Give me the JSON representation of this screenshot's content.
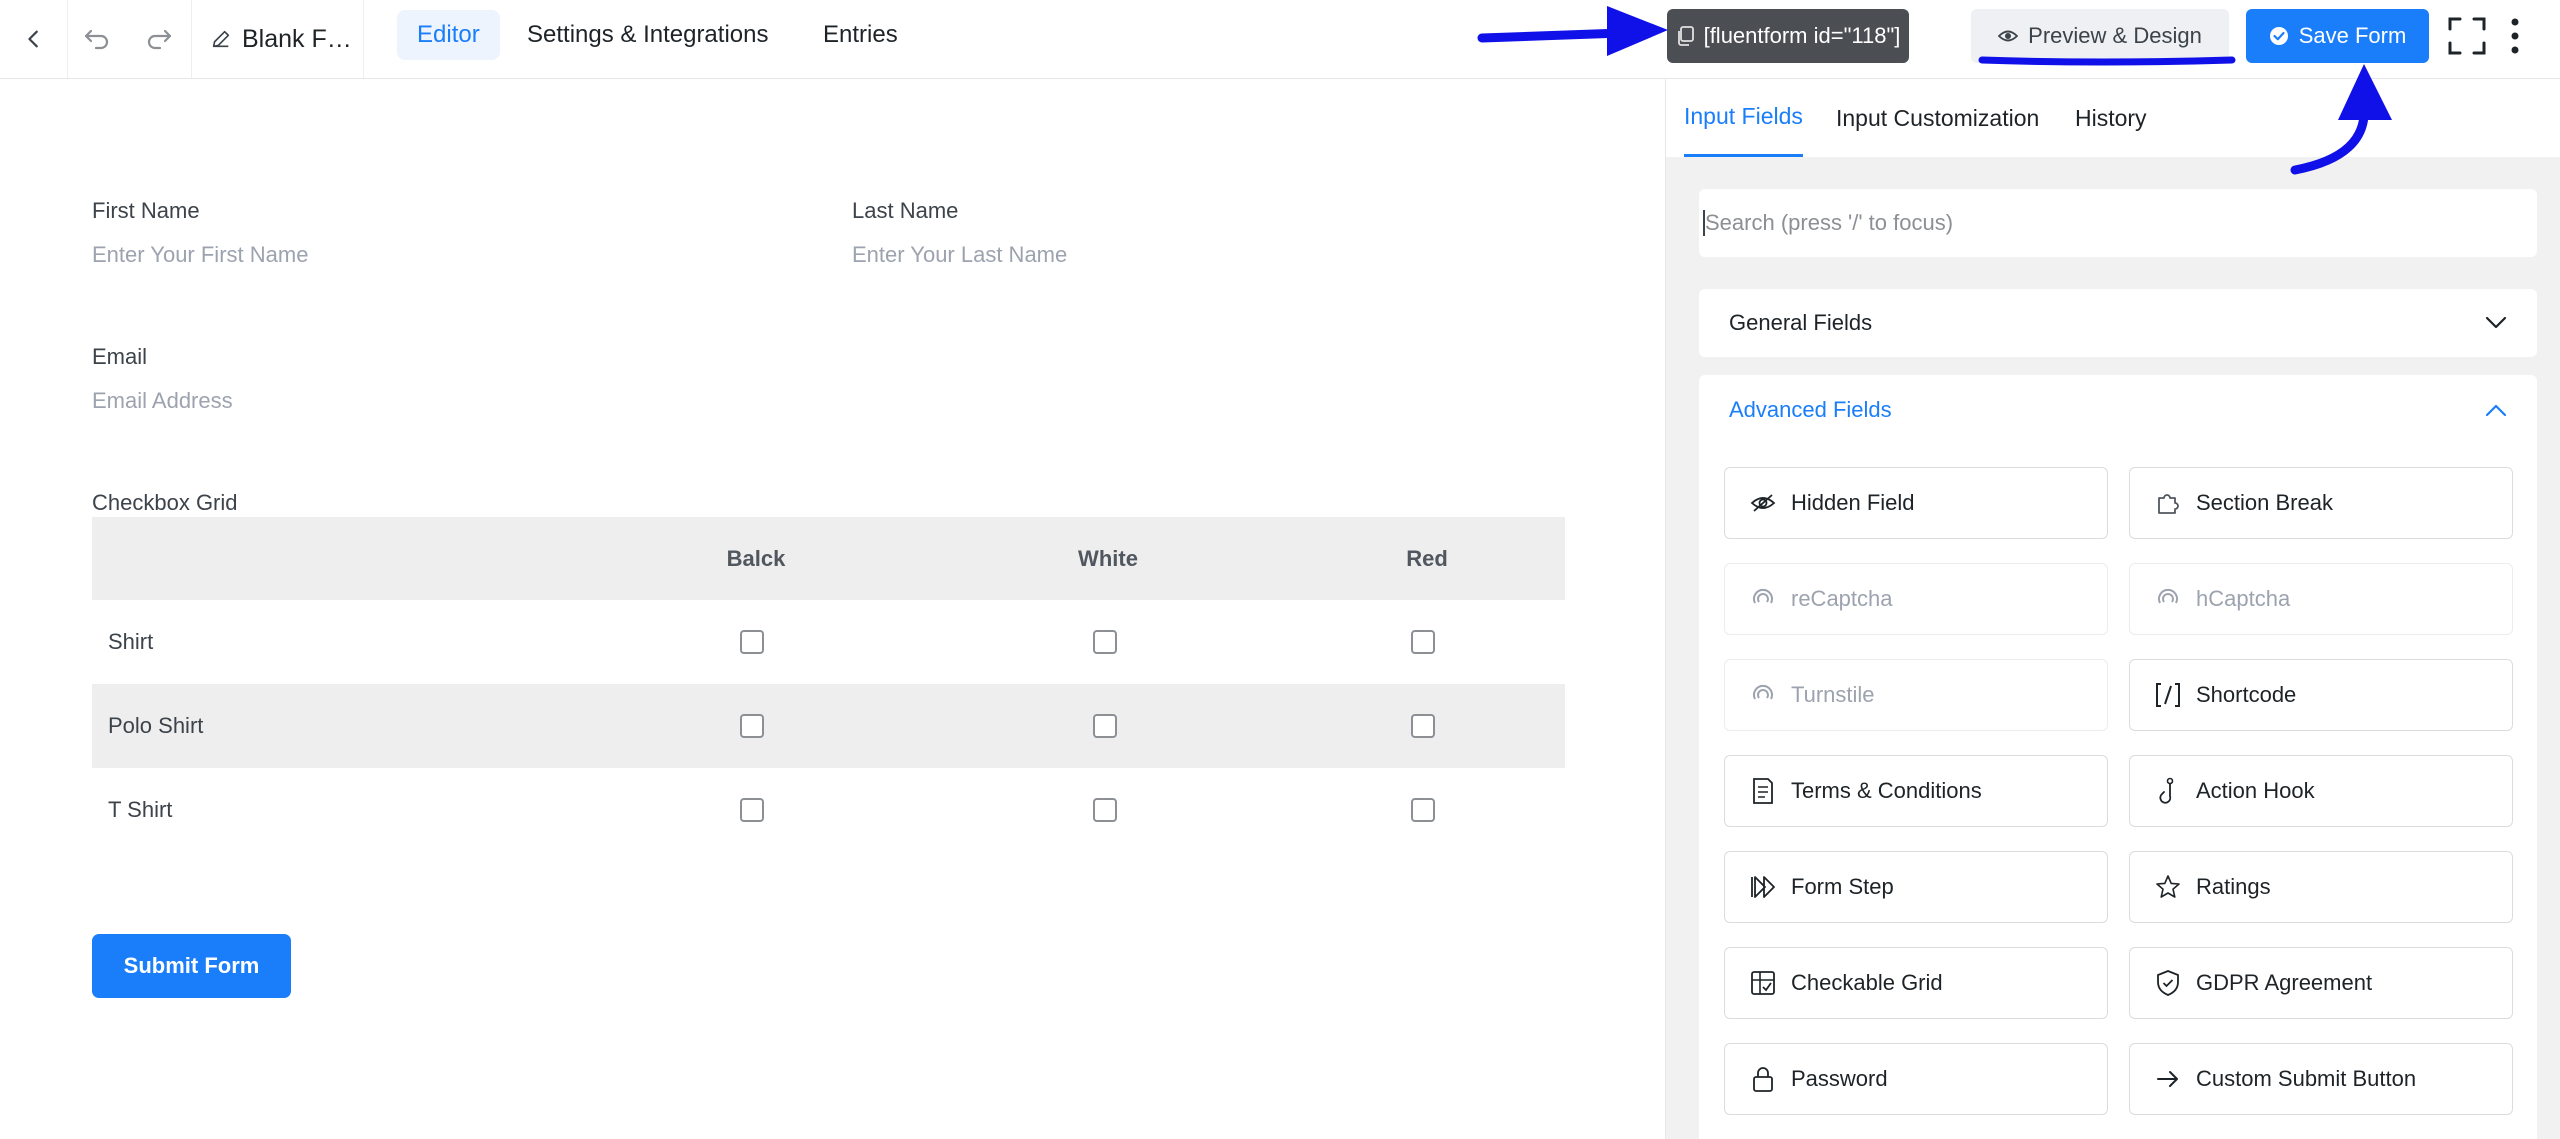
{
  "topbar": {
    "form_title": "Blank F…",
    "tabs": [
      {
        "label": "Editor",
        "active": true
      },
      {
        "label": "Settings & Integrations",
        "active": false
      },
      {
        "label": "Entries",
        "active": false
      }
    ],
    "shortcode_label": "[fluentform id=\"118\"]",
    "preview_label": "Preview & Design",
    "save_label": "Save Form"
  },
  "form": {
    "first_name": {
      "label": "First Name",
      "placeholder": "Enter Your First Name"
    },
    "last_name": {
      "label": "Last Name",
      "placeholder": "Enter Your Last Name"
    },
    "email": {
      "label": "Email",
      "placeholder": "Email Address"
    },
    "checkbox_grid": {
      "label": "Checkbox Grid",
      "columns": [
        "Balck",
        "White",
        "Red"
      ],
      "rows": [
        "Shirt",
        "Polo Shirt",
        "T Shirt"
      ]
    },
    "submit_label": "Submit Form"
  },
  "sidebar": {
    "tabs": [
      {
        "label": "Input Fields",
        "active": true
      },
      {
        "label": "Input Customization",
        "active": false
      },
      {
        "label": "History",
        "active": false
      }
    ],
    "search_placeholder": "Search (press '/' to focus)",
    "general_label": "General Fields",
    "advanced_label": "Advanced Fields",
    "advanced_fields": [
      {
        "label": "Hidden Field",
        "icon": "eye-slash-icon",
        "enabled": true
      },
      {
        "label": "Section Break",
        "icon": "puzzle-icon",
        "enabled": true
      },
      {
        "label": "reCaptcha",
        "icon": "recaptcha-icon",
        "enabled": false
      },
      {
        "label": "hCaptcha",
        "icon": "hcaptcha-icon",
        "enabled": false
      },
      {
        "label": "Turnstile",
        "icon": "turnstile-icon",
        "enabled": false
      },
      {
        "label": "Shortcode",
        "icon": "shortcode-icon",
        "enabled": true
      },
      {
        "label": "Terms & Conditions",
        "icon": "document-icon",
        "enabled": true
      },
      {
        "label": "Action Hook",
        "icon": "hook-icon",
        "enabled": true
      },
      {
        "label": "Form Step",
        "icon": "fast-forward-icon",
        "enabled": true
      },
      {
        "label": "Ratings",
        "icon": "star-icon",
        "enabled": true
      },
      {
        "label": "Checkable Grid",
        "icon": "grid-check-icon",
        "enabled": true
      },
      {
        "label": "GDPR Agreement",
        "icon": "shield-icon",
        "enabled": true
      },
      {
        "label": "Password",
        "icon": "lock-icon",
        "enabled": true
      },
      {
        "label": "Custom Submit Button",
        "icon": "arrow-right-icon",
        "enabled": true
      }
    ]
  },
  "colors": {
    "accent": "#1a7efb",
    "shortcode_bg": "#4b4f54",
    "annotation": "#1010e8"
  }
}
